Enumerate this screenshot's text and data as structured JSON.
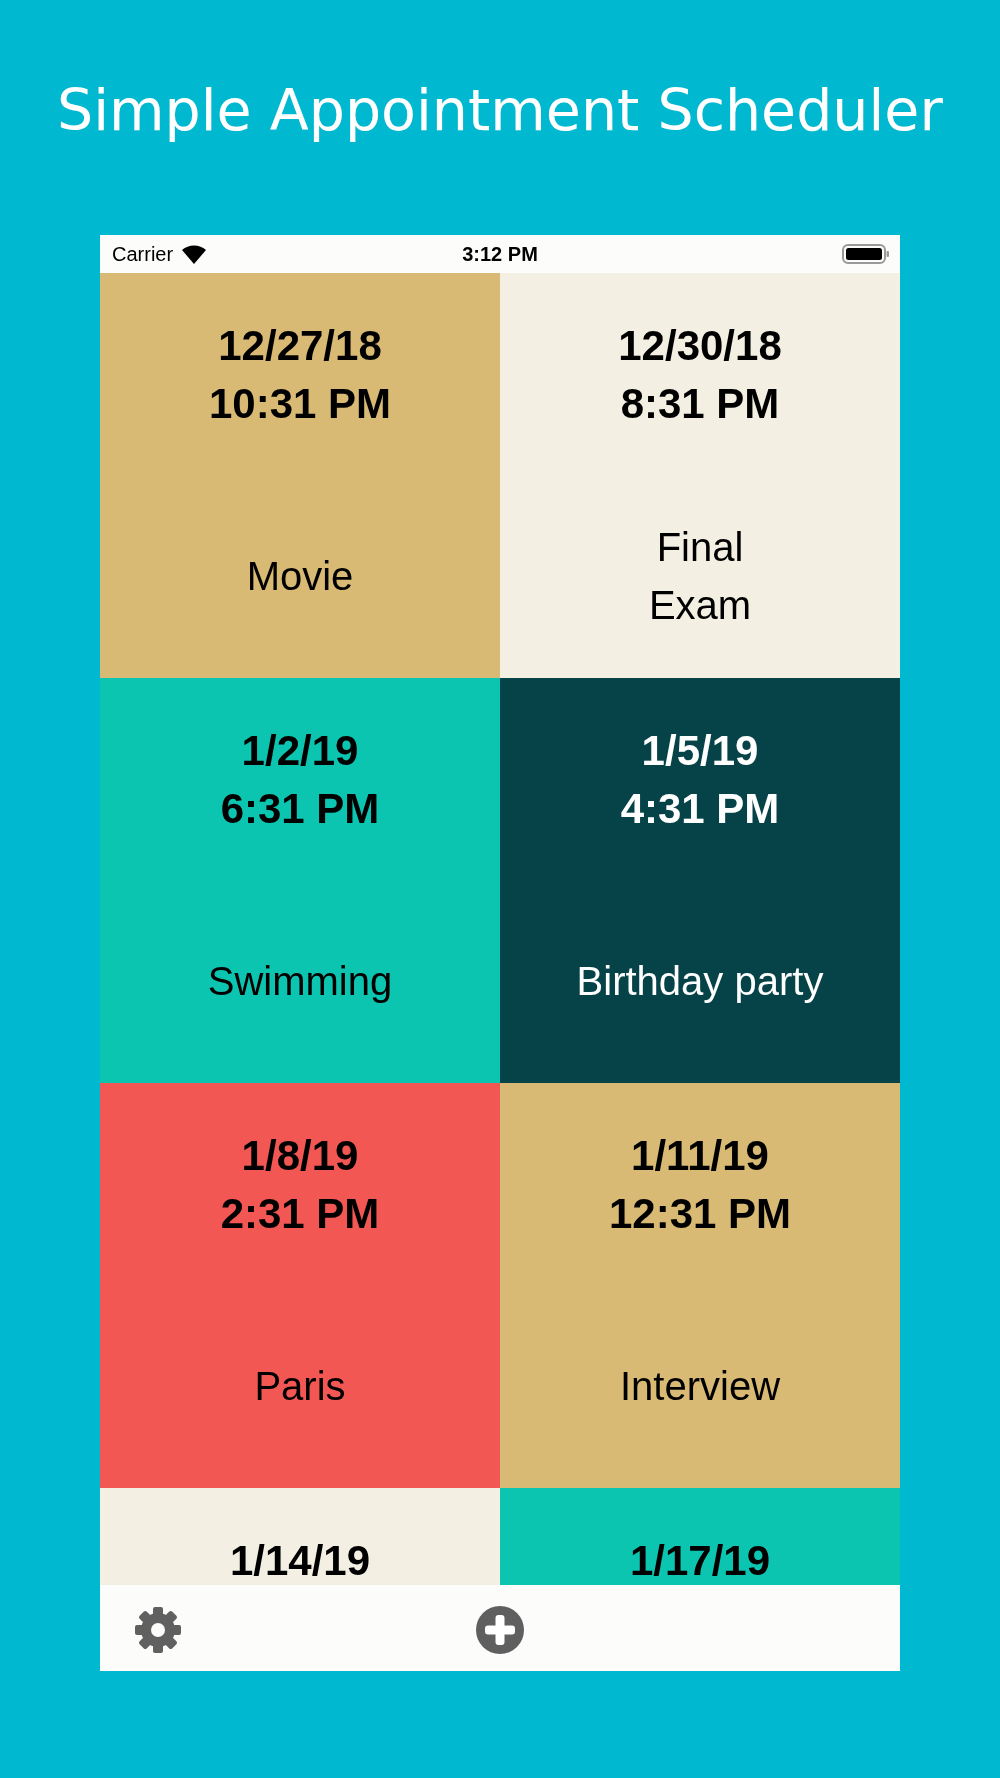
{
  "title": "Simple Appointment Scheduler",
  "status_bar": {
    "carrier": "Carrier",
    "time": "3:12 PM"
  },
  "appointments": [
    {
      "date": "12/27/18",
      "time": "10:31 PM",
      "title": "Movie",
      "color": "#d9ba74"
    },
    {
      "date": "12/30/18",
      "time": "8:31 PM",
      "title": "Final\nExam",
      "color": "#f3f0e3"
    },
    {
      "date": "1/2/19",
      "time": "6:31 PM",
      "title": "Swimming",
      "color": "#0cc5b1"
    },
    {
      "date": "1/5/19",
      "time": "4:31 PM",
      "title": "Birthday party",
      "color": "#064348"
    },
    {
      "date": "1/8/19",
      "time": "2:31 PM",
      "title": "Paris",
      "color": "#f25753"
    },
    {
      "date": "1/11/19",
      "time": "12:31 PM",
      "title": "Interview",
      "color": "#d9ba74"
    },
    {
      "date": "1/14/19",
      "color": "#f3f0e3"
    },
    {
      "date": "1/17/19",
      "color": "#0cc5b1"
    }
  ],
  "toolbar": [
    {
      "kind": "settings"
    },
    {
      "kind": "add"
    }
  ]
}
